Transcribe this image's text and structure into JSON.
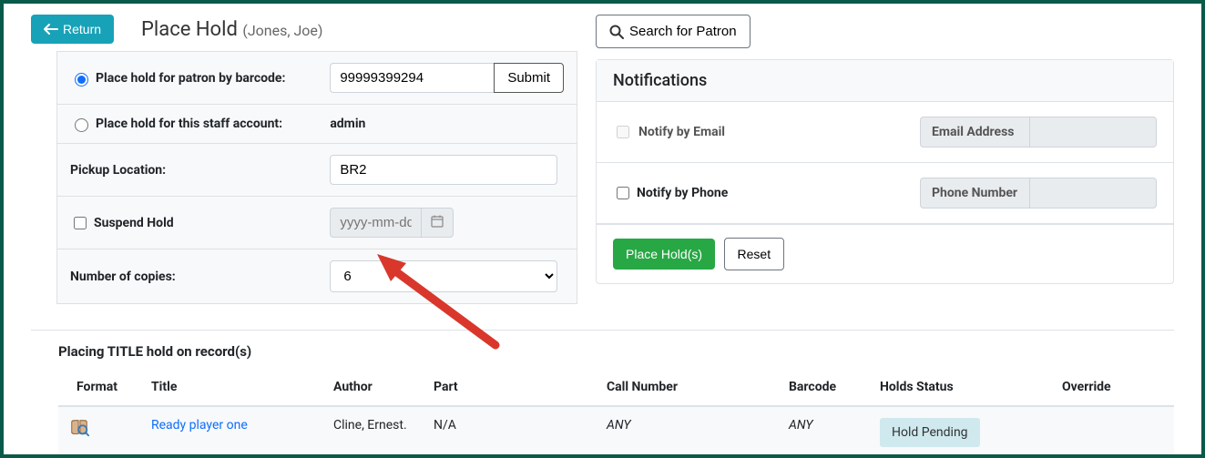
{
  "header": {
    "return_label": "Return",
    "title": "Place Hold",
    "patron": "(Jones, Joe)"
  },
  "form": {
    "by_barcode_label": "Place hold for patron by barcode:",
    "barcode_value": "99999399294",
    "submit_label": "Submit",
    "by_staff_label": "Place hold for this staff account:",
    "staff_value": "admin",
    "pickup_label": "Pickup Location:",
    "pickup_value": "BR2",
    "suspend_label": "Suspend Hold",
    "date_placeholder": "yyyy-mm-dd",
    "copies_label": "Number of copies:",
    "copies_value": "6"
  },
  "right": {
    "search_patron_label": "Search for Patron",
    "notifications_title": "Notifications",
    "notify_email_label": "Notify by Email",
    "email_addon": "Email Address",
    "notify_phone_label": "Notify by Phone",
    "phone_addon": "Phone Number",
    "place_holds_label": "Place Hold(s)",
    "reset_label": "Reset"
  },
  "records": {
    "heading": "Placing TITLE hold on record(s)",
    "columns": {
      "format": "Format",
      "title": "Title",
      "author": "Author",
      "part": "Part",
      "call_number": "Call Number",
      "barcode": "Barcode",
      "holds_status": "Holds Status",
      "override": "Override"
    },
    "row": {
      "title": "Ready player one",
      "author": "Cline, Ernest.",
      "part": "N/A",
      "call_number": "ANY",
      "barcode": "ANY",
      "status": "Hold Pending"
    }
  }
}
